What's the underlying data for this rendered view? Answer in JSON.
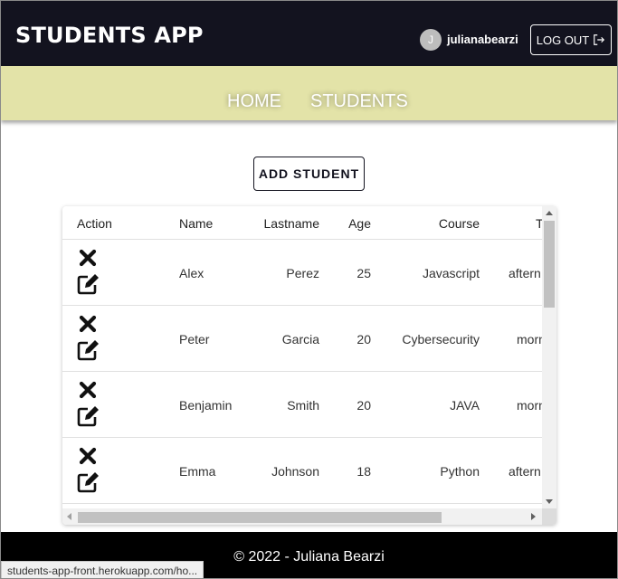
{
  "header": {
    "title": "STUDENTS APP",
    "avatar_initial": "J",
    "username": "julianabearzi",
    "logout_label": "LOG OUT"
  },
  "nav": {
    "items": [
      {
        "label": "HOME"
      },
      {
        "label": "STUDENTS"
      }
    ]
  },
  "main": {
    "add_button_label": "ADD STUDENT"
  },
  "table": {
    "columns": [
      "Action",
      "Name",
      "Lastname",
      "Age",
      "Course",
      "T"
    ],
    "rows": [
      {
        "name": "Alex",
        "lastname": "Perez",
        "age": "25",
        "course": "Javascript",
        "turn": "aftern"
      },
      {
        "name": "Peter",
        "lastname": "Garcia",
        "age": "20",
        "course": "Cybersecurity",
        "turn": "morn"
      },
      {
        "name": "Benjamin",
        "lastname": "Smith",
        "age": "20",
        "course": "JAVA",
        "turn": "morn"
      },
      {
        "name": "Emma",
        "lastname": "Johnson",
        "age": "18",
        "course": "Python",
        "turn": "aftern"
      }
    ]
  },
  "footer": {
    "text": "© 2022 - Juliana Bearzi"
  },
  "status_bar": {
    "url": "students-app-front.herokuapp.com/ho..."
  },
  "colors": {
    "header_bg": "#13131f",
    "nav_bg": "#e3e3a8",
    "footer_bg": "#000000"
  }
}
